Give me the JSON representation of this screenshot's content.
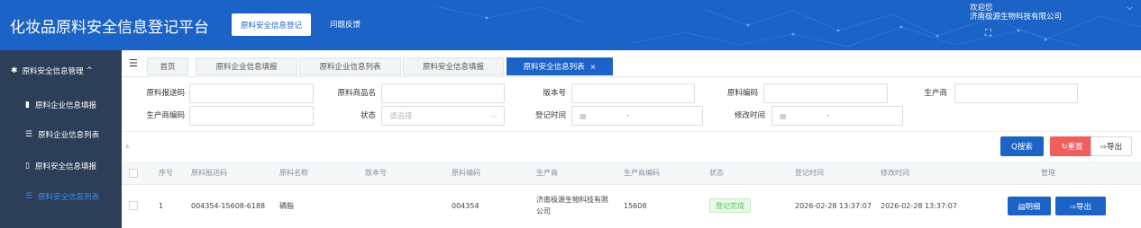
{
  "header": {
    "title": "化妆品原料安全信息登记平台",
    "nav_active": "原料安全信息登记",
    "nav_link": "问题反馈",
    "welcome_line1": "欢迎您",
    "welcome_line2": "济南极源生物科技有限公司",
    "user_chevron_icon": "chevron-down-icon",
    "fullscreen_icon": "expand-icon"
  },
  "sidebar": {
    "group": "原料安全信息管理",
    "group_icon": "gear-icon",
    "items": [
      {
        "label": "原料企业信息填报",
        "icon": "file-icon"
      },
      {
        "label": "原料企业信息列表",
        "icon": "list-icon"
      },
      {
        "label": "原料安全信息填报",
        "icon": "file-icon"
      },
      {
        "label": "原料安全信息列表",
        "icon": "list-icon",
        "active": true
      }
    ]
  },
  "tabs": {
    "menu_icon": "menu-icon",
    "items": [
      {
        "label": "首页"
      },
      {
        "label": "原料企业信息填报"
      },
      {
        "label": "原料企业信息列表"
      },
      {
        "label": "原料安全信息填报"
      },
      {
        "label": "原料安全信息列表",
        "active": true,
        "close": "×"
      }
    ]
  },
  "filters": {
    "raw_report_code": {
      "label": "原料报送码",
      "value": ""
    },
    "raw_product_name": {
      "label": "原料商品名",
      "value": ""
    },
    "version": {
      "label": "版本号",
      "value": ""
    },
    "raw_code": {
      "label": "原料编码",
      "value": ""
    },
    "manufacturer": {
      "label": "生产商",
      "value": ""
    },
    "manufacturer_code": {
      "label": "生产商编码",
      "value": ""
    },
    "status": {
      "label": "状态",
      "placeholder": "请选择"
    },
    "register_time": {
      "label": "登记时间",
      "separator": "-"
    },
    "modify_time": {
      "label": "修改时间",
      "separator": "-"
    }
  },
  "toolbar": {
    "search": "Q搜索",
    "reset": "↻重置",
    "export": "⇨导出"
  },
  "table": {
    "columns": [
      "序号",
      "原料报送码",
      "原料名称",
      "版本号",
      "原料编码",
      "生产商",
      "生产商编码",
      "状态",
      "登记时间",
      "修改时间",
      "管理"
    ],
    "rows": [
      {
        "index": "1",
        "report_code": "004354-15608-6188",
        "name": "磷脂",
        "version": "",
        "raw_code": "004354",
        "manufacturer": "济南极源生物科技有限公司",
        "manufacturer_code": "15608",
        "status": "登记完成",
        "register_time": "2026-02-28 13:37:07",
        "modify_time": "2026-02-28 13:37:07",
        "detail": "▤明细",
        "export": "⇨导出"
      }
    ]
  },
  "colors": {
    "primary": "#1c63c8",
    "sidebar": "#2c3e58",
    "danger": "#ef5d5d",
    "success": "#52c45a"
  }
}
